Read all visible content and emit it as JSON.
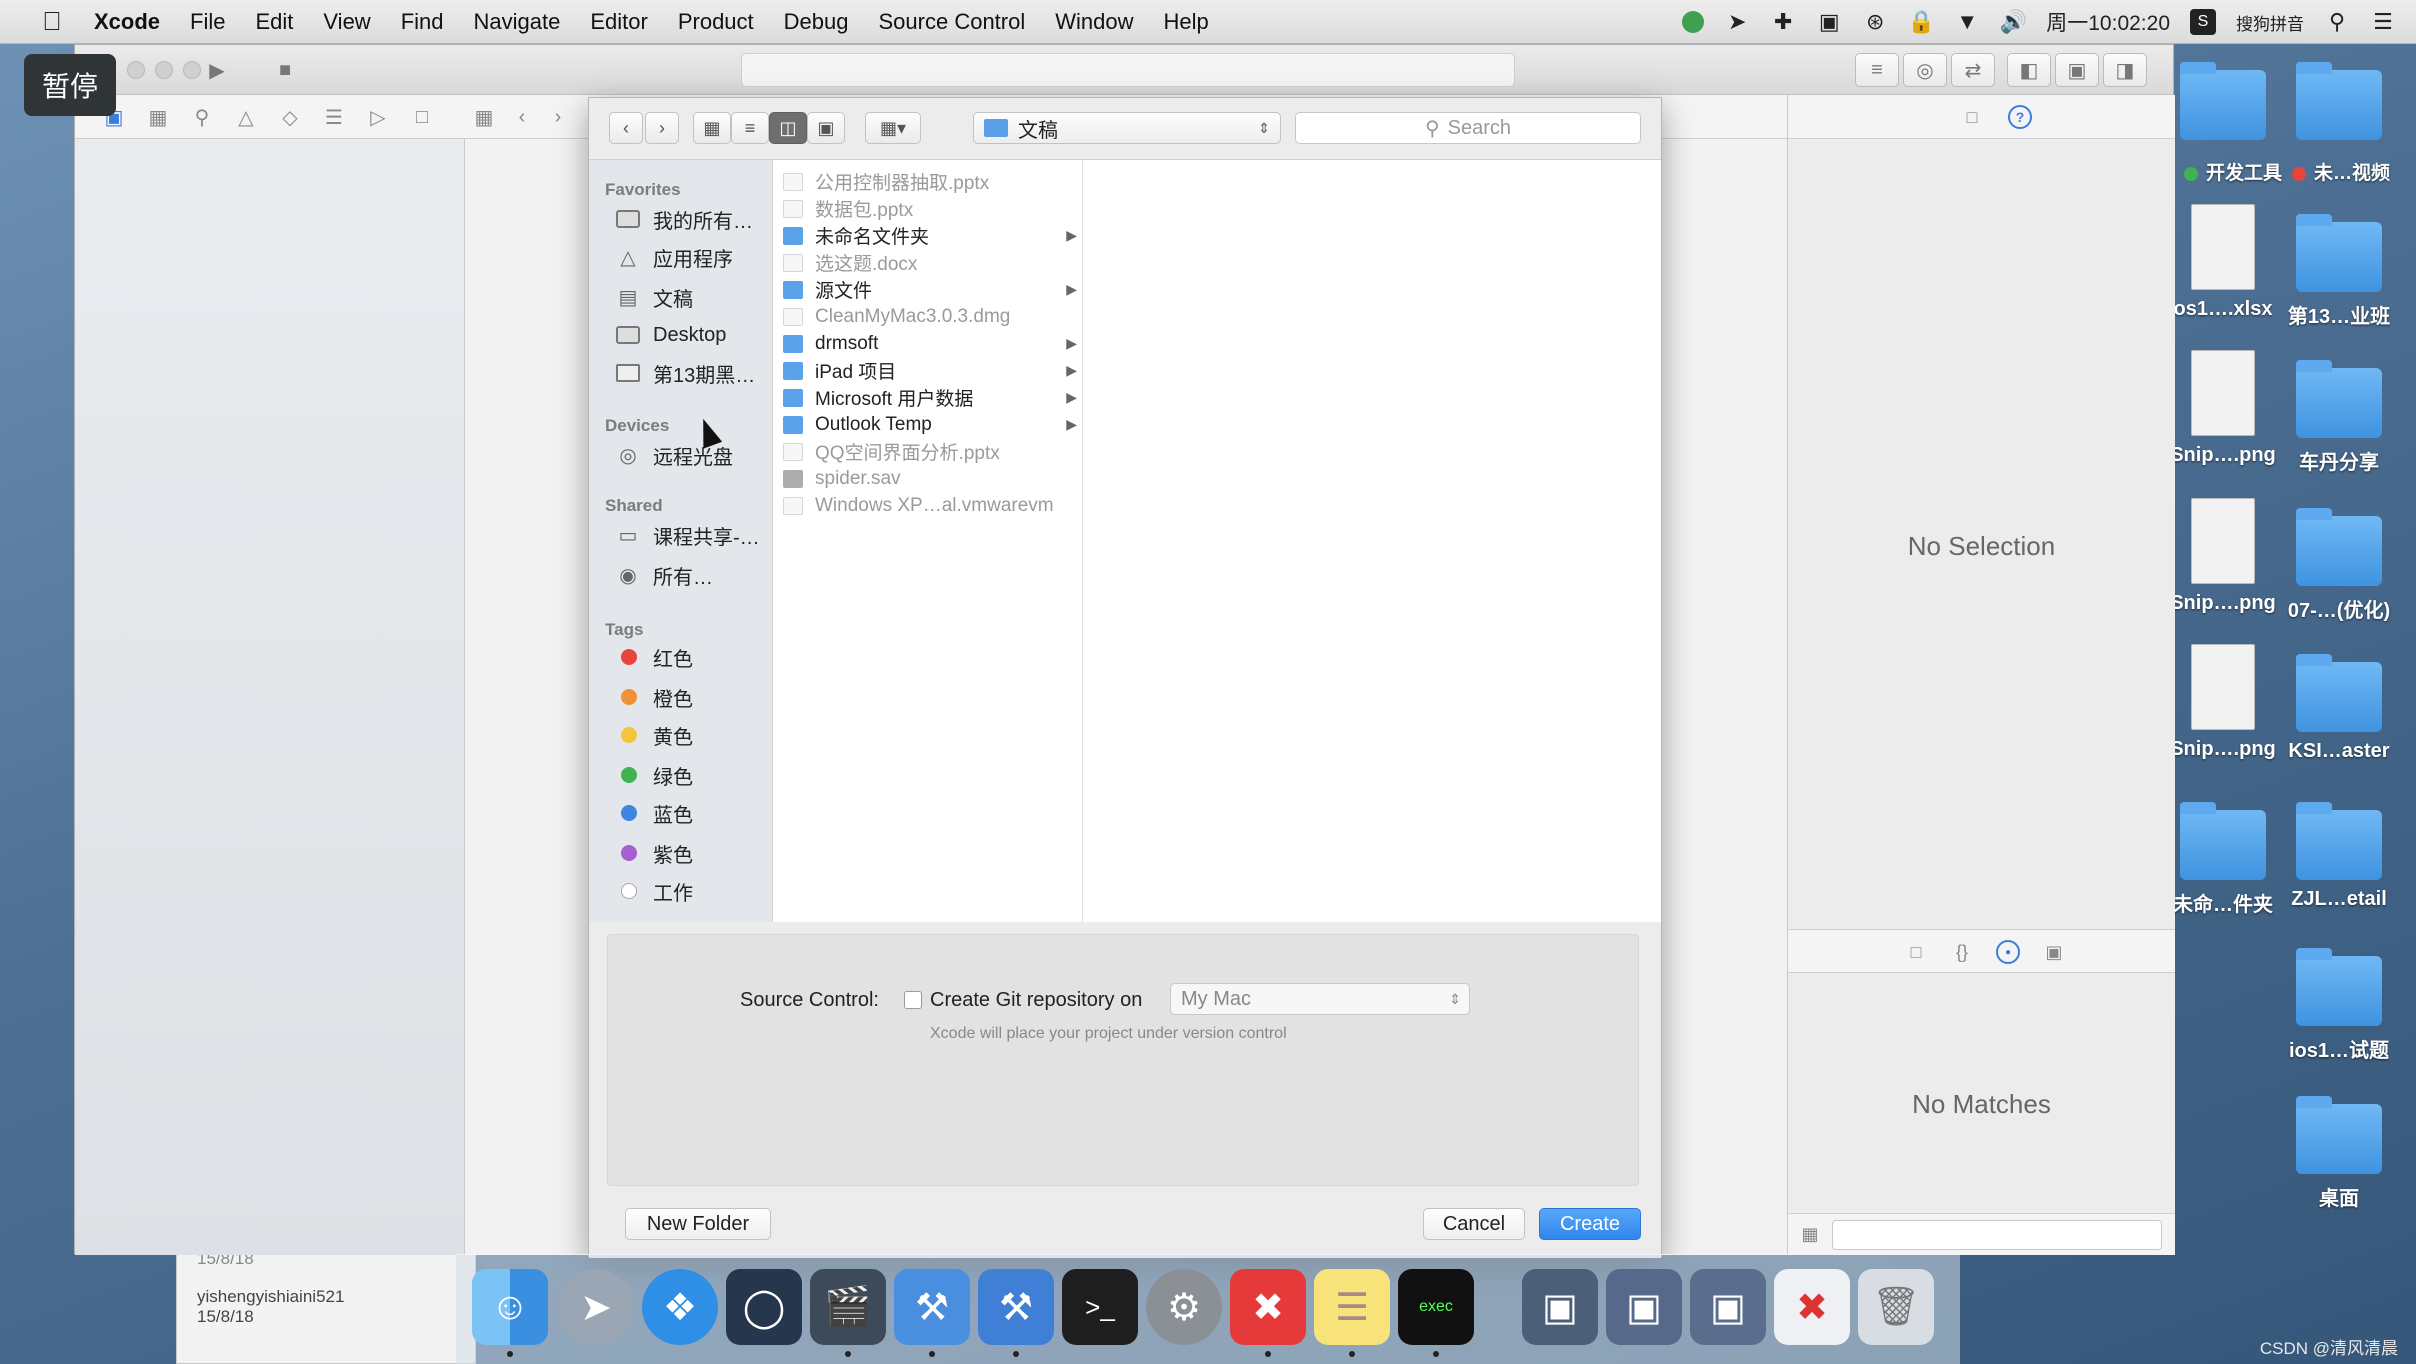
{
  "menubar": {
    "app": "Xcode",
    "items": [
      "File",
      "Edit",
      "View",
      "Find",
      "Navigate",
      "Editor",
      "Product",
      "Debug",
      "Source Control",
      "Window",
      "Help"
    ],
    "clock": "周一10:02:20",
    "input_method": "搜狗拼音"
  },
  "overlay": {
    "pause_label": "暂停"
  },
  "dialog": {
    "location": "文稿",
    "search_placeholder": "Search",
    "sidebar": {
      "favorites_header": "Favorites",
      "favorites": [
        "我的所有…",
        "应用程序",
        "文稿",
        "Desktop",
        "第13期黑…"
      ],
      "devices_header": "Devices",
      "devices": [
        "远程光盘"
      ],
      "shared_header": "Shared",
      "shared": [
        "课程共享-…",
        "所有…"
      ],
      "tags_header": "Tags",
      "tags": [
        {
          "name": "红色",
          "color": "#e8443a"
        },
        {
          "name": "橙色",
          "color": "#f0913a"
        },
        {
          "name": "黄色",
          "color": "#f2c53d"
        },
        {
          "name": "绿色",
          "color": "#3fb34f"
        },
        {
          "name": "蓝色",
          "color": "#3b86e0"
        },
        {
          "name": "紫色",
          "color": "#a45fd0"
        },
        {
          "name": "工作",
          "color": "#d8d8d8"
        }
      ]
    },
    "files": [
      {
        "name": "公用控制器抽取.pptx",
        "kind": "doc",
        "dim": true,
        "folder": false
      },
      {
        "name": "数据包.pptx",
        "kind": "doc",
        "dim": true,
        "folder": false
      },
      {
        "name": "未命名文件夹",
        "kind": "folder",
        "dim": false,
        "folder": true
      },
      {
        "name": "选这题.docx",
        "kind": "doc",
        "dim": true,
        "folder": false
      },
      {
        "name": "源文件",
        "kind": "folder",
        "dim": false,
        "folder": true
      },
      {
        "name": "CleanMyMac3.0.3.dmg",
        "kind": "doc",
        "dim": true,
        "folder": false
      },
      {
        "name": "drmsoft",
        "kind": "folder",
        "dim": false,
        "folder": true
      },
      {
        "name": "iPad 项目",
        "kind": "folder",
        "dim": false,
        "folder": true
      },
      {
        "name": "Microsoft 用户数据",
        "kind": "folder",
        "dim": false,
        "folder": true
      },
      {
        "name": "Outlook Temp",
        "kind": "folder",
        "dim": false,
        "folder": true
      },
      {
        "name": "QQ空间界面分析.pptx",
        "kind": "doc",
        "dim": true,
        "folder": false
      },
      {
        "name": "spider.sav",
        "kind": "dark",
        "dim": true,
        "folder": false
      },
      {
        "name": "Windows XP…al.vmwarevm",
        "kind": "doc",
        "dim": true,
        "folder": false
      }
    ],
    "source_control": {
      "label": "Source Control:",
      "checkbox_label": "Create Git repository on",
      "target": "My Mac",
      "hint": "Xcode will place your project under version control"
    },
    "buttons": {
      "new_folder": "New Folder",
      "cancel": "Cancel",
      "create": "Create"
    }
  },
  "inspector": {
    "no_selection": "No Selection",
    "no_matches": "No Matches"
  },
  "desktop": {
    "top_labels": [
      {
        "name": "开发工具",
        "tag": "#3fb34f"
      },
      {
        "name": "未…视频",
        "tag": "#e8443a"
      }
    ],
    "icons": [
      {
        "name": "os1….xlsx",
        "kind": "file"
      },
      {
        "name": "第13…业班",
        "kind": "folder"
      },
      {
        "name": "Snip….png",
        "kind": "file"
      },
      {
        "name": "车丹分享",
        "kind": "folder"
      },
      {
        "name": "Snip….png",
        "kind": "file"
      },
      {
        "name": "07-…(优化)",
        "kind": "folder"
      },
      {
        "name": "Snip….png",
        "kind": "file"
      },
      {
        "name": "KSI…aster",
        "kind": "folder"
      },
      {
        "name": "未命…件夹",
        "kind": "folder"
      },
      {
        "name": "ZJL…etail",
        "kind": "folder"
      },
      {
        "name": "ios1…试题",
        "kind": "folder"
      },
      {
        "name": "桌面",
        "kind": "folder"
      }
    ]
  },
  "background_window": {
    "date1": "15/8/18",
    "user": "yishengyishiaini521",
    "date2": "15/8/18"
  },
  "watermark": "CSDN @清风清晨"
}
